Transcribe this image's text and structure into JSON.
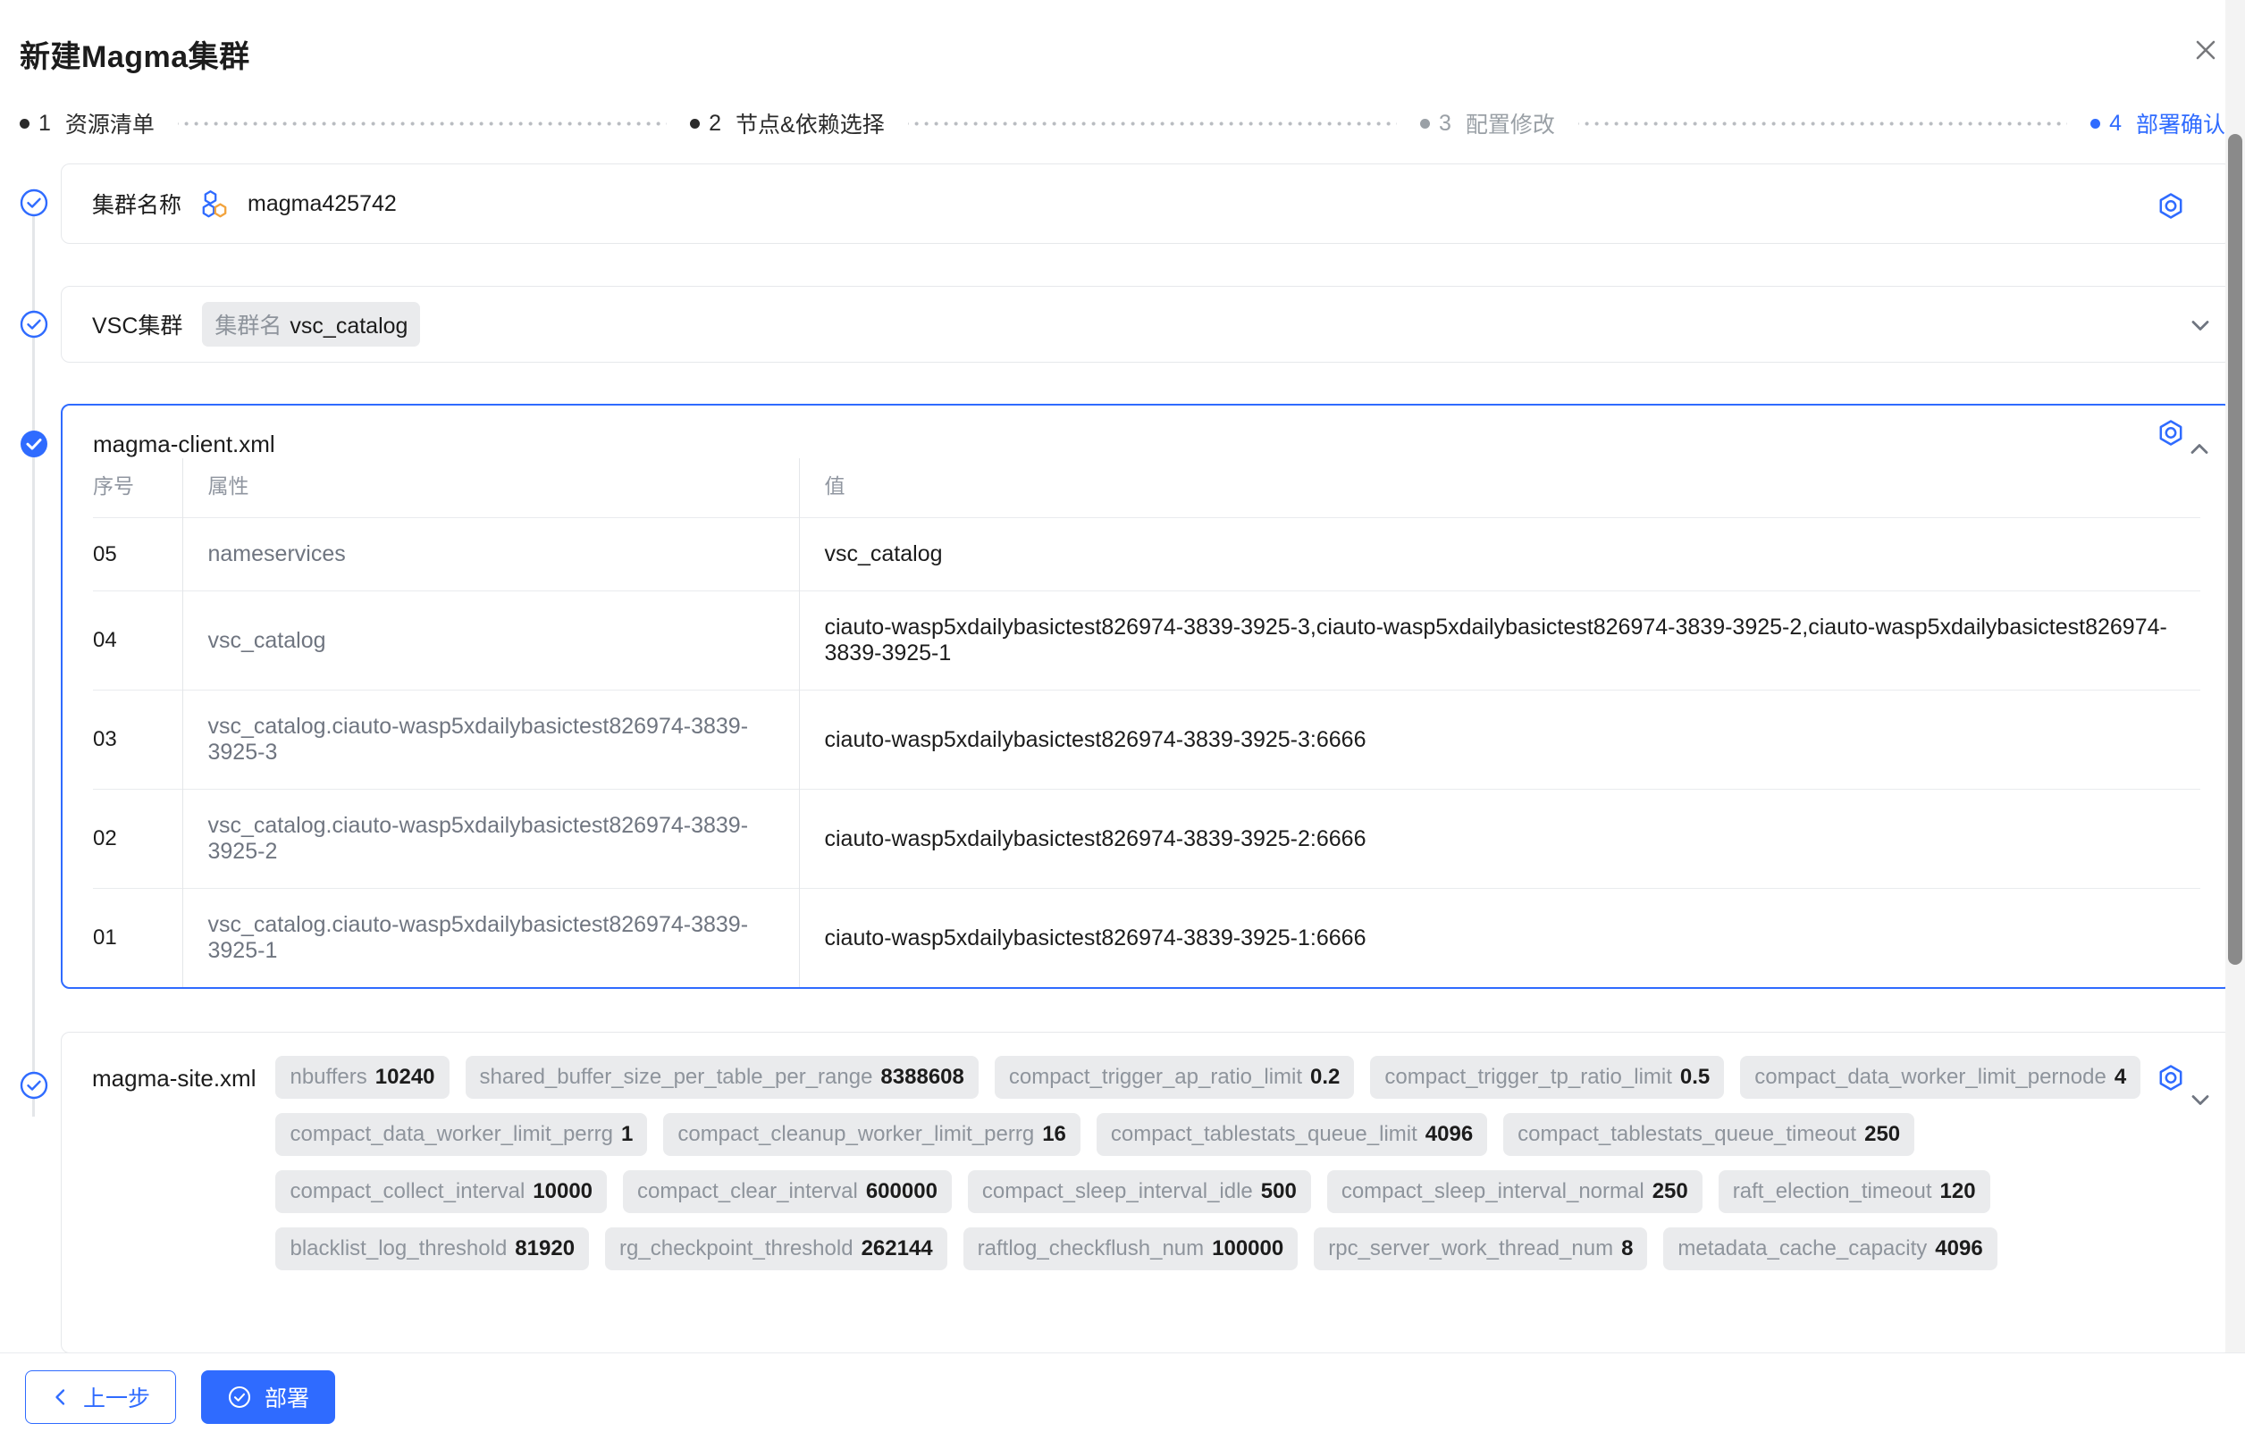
{
  "dialog": {
    "title": "新建Magma集群",
    "close_icon": "close-icon"
  },
  "steps": [
    {
      "num": "1",
      "label": "资源清单",
      "state": "done"
    },
    {
      "num": "2",
      "label": "节点&依赖选择",
      "state": "done"
    },
    {
      "num": "3",
      "label": "配置修改",
      "state": "dim"
    },
    {
      "num": "4",
      "label": "部署确认",
      "state": "active"
    }
  ],
  "sections": {
    "cluster_name": {
      "label": "集群名称",
      "icon": "magma-cluster-icon",
      "value": "magma425742",
      "action_icon": "hex-target-icon"
    },
    "vsc_cluster": {
      "label": "VSC集群",
      "chip_key": "集群名",
      "chip_value": "vsc_catalog",
      "caret_icon": "chevron-down-icon"
    },
    "magma_client": {
      "title": "magma-client.xml",
      "caret_icon": "chevron-up-icon",
      "action_icon": "hex-target-icon",
      "columns": [
        "序号",
        "属性",
        "值"
      ],
      "rows": [
        {
          "idx": "05",
          "attr": "nameservices",
          "value": "vsc_catalog"
        },
        {
          "idx": "04",
          "attr": "vsc_catalog",
          "value": "ciauto-wasp5xdailybasictest826974-3839-3925-3,ciauto-wasp5xdailybasictest826974-3839-3925-2,ciauto-wasp5xdailybasictest826974-3839-3925-1"
        },
        {
          "idx": "03",
          "attr": "vsc_catalog.ciauto-wasp5xdailybasictest826974-3839-3925-3",
          "value": "ciauto-wasp5xdailybasictest826974-3839-3925-3:6666"
        },
        {
          "idx": "02",
          "attr": "vsc_catalog.ciauto-wasp5xdailybasictest826974-3839-3925-2",
          "value": "ciauto-wasp5xdailybasictest826974-3839-3925-2:6666"
        },
        {
          "idx": "01",
          "attr": "vsc_catalog.ciauto-wasp5xdailybasictest826974-3839-3925-1",
          "value": "ciauto-wasp5xdailybasictest826974-3839-3925-1:6666"
        }
      ]
    },
    "magma_site": {
      "title": "magma-site.xml",
      "caret_icon": "chevron-down-icon",
      "action_icon": "hex-target-icon",
      "tags": [
        {
          "key": "nbuffers",
          "value": "10240"
        },
        {
          "key": "shared_buffer_size_per_table_per_range",
          "value": "8388608"
        },
        {
          "key": "compact_trigger_ap_ratio_limit",
          "value": "0.2"
        },
        {
          "key": "compact_trigger_tp_ratio_limit",
          "value": "0.5"
        },
        {
          "key": "compact_data_worker_limit_pernode",
          "value": "4"
        },
        {
          "key": "compact_data_worker_limit_perrg",
          "value": "1"
        },
        {
          "key": "compact_cleanup_worker_limit_perrg",
          "value": "16"
        },
        {
          "key": "compact_tablestats_queue_limit",
          "value": "4096"
        },
        {
          "key": "compact_tablestats_queue_timeout",
          "value": "250"
        },
        {
          "key": "compact_collect_interval",
          "value": "10000"
        },
        {
          "key": "compact_clear_interval",
          "value": "600000"
        },
        {
          "key": "compact_sleep_interval_idle",
          "value": "500"
        },
        {
          "key": "compact_sleep_interval_normal",
          "value": "250"
        },
        {
          "key": "raft_election_timeout",
          "value": "120"
        },
        {
          "key": "blacklist_log_threshold",
          "value": "81920"
        },
        {
          "key": "rg_checkpoint_threshold",
          "value": "262144"
        },
        {
          "key": "raftlog_checkflush_num",
          "value": "100000"
        },
        {
          "key": "rpc_server_work_thread_num",
          "value": "8"
        },
        {
          "key": "metadata_cache_capacity",
          "value": "4096"
        }
      ]
    }
  },
  "footer": {
    "prev_label": "上一步",
    "prev_icon": "chevron-left-icon",
    "deploy_label": "部署",
    "deploy_icon": "check-circle-icon"
  },
  "colors": {
    "accent": "#2f6bff",
    "chip_bg": "#eaebed",
    "muted_text": "#8e949c",
    "border": "#e6e8eb"
  }
}
